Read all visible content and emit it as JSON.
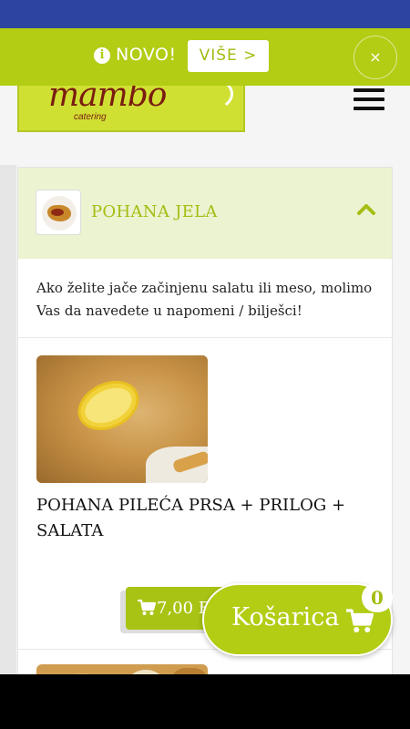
{
  "banner": {
    "info_icon": "info-circle-icon",
    "info_glyph": "i",
    "text": "NOVO!",
    "button_label": "VIŠE >",
    "close_label": "×"
  },
  "logo": {
    "text": "mambo",
    "subtext": "catering"
  },
  "category": {
    "title": "POHANA JELA",
    "expanded": true,
    "note": "Ako želite jače začinjenu salatu ili meso, molimo Vas da navedete u napomeni / bilješci!"
  },
  "items": [
    {
      "title": "POHANA PILEĆA PRSA + PRILOG + SALATA",
      "price": "7,00 EUR (52,74 KN)"
    }
  ],
  "cart": {
    "label": "Košarica",
    "count": "0"
  },
  "colors": {
    "accent": "#b3cc14",
    "status_bar": "#2e45a0",
    "category_bg": "#ecf3d1"
  }
}
